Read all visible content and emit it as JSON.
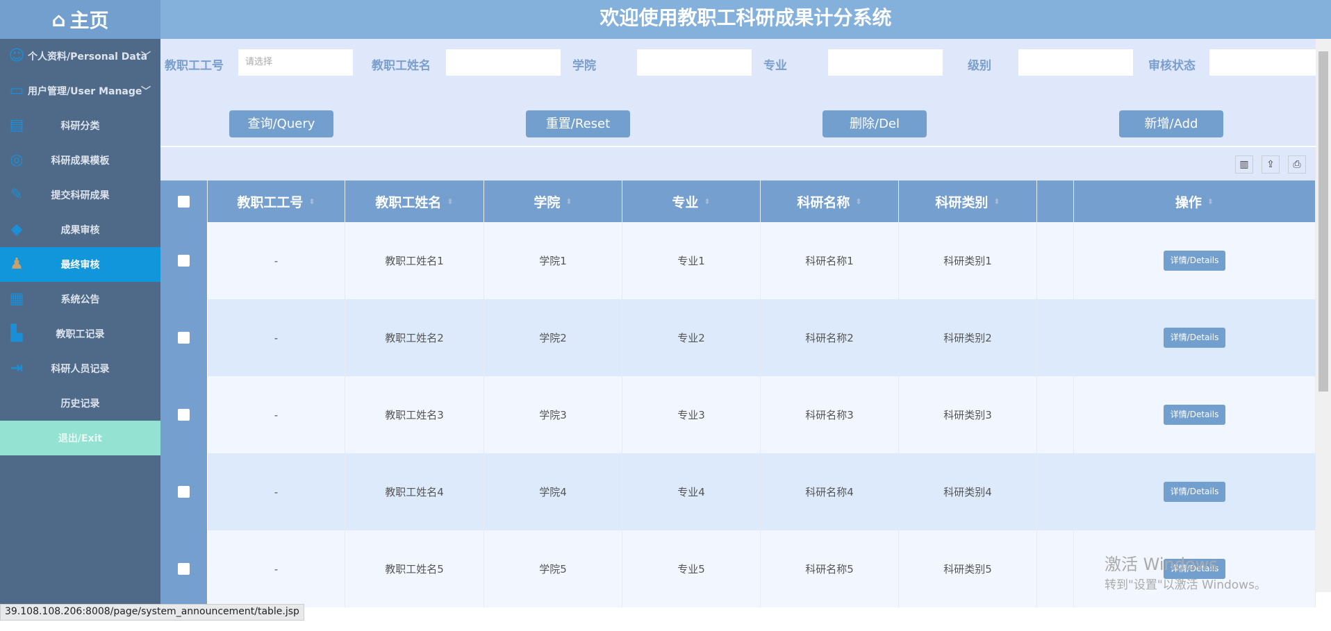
{
  "logo": {
    "label": "主页",
    "icon": "home-icon"
  },
  "header": {
    "title": "欢迎使用教职工科研成果计分系统"
  },
  "sidebar": {
    "items": [
      {
        "label": "个人资料/Personal Data",
        "icon": "user-circle-icon",
        "group": true
      },
      {
        "label": "用户管理/User Manage",
        "icon": "monitor-icon",
        "group": true
      },
      {
        "label": "科研分类",
        "icon": "id-card-icon"
      },
      {
        "label": "科研成果模板",
        "icon": "template-icon"
      },
      {
        "label": "提交科研成果",
        "icon": "pencil-icon"
      },
      {
        "label": "成果审核",
        "icon": "tag-icon"
      },
      {
        "label": "最终审核",
        "icon": "users-icon",
        "active": true
      },
      {
        "label": "系统公告",
        "icon": "notice-board-icon"
      },
      {
        "label": "教职工记录",
        "icon": "save-icon"
      },
      {
        "label": "科研人员记录",
        "icon": "sign-out-icon"
      },
      {
        "label": "历史记录",
        "icon": ""
      },
      {
        "label": "退出/Exit",
        "icon": "",
        "exit": true
      }
    ]
  },
  "search": {
    "fields": [
      {
        "label": "教职工工号",
        "value": "",
        "placeholder": "请选择"
      },
      {
        "label": "教职工姓名",
        "value": "",
        "placeholder": ""
      },
      {
        "label": "学院",
        "value": "",
        "placeholder": ""
      },
      {
        "label": "专业",
        "value": "",
        "placeholder": ""
      },
      {
        "label": "级别",
        "value": "",
        "placeholder": ""
      },
      {
        "label": "审核状态",
        "value": "",
        "placeholder": ""
      }
    ],
    "buttons": [
      "查询/Query",
      "重置/Reset",
      "删除/Del",
      "新增/Add"
    ]
  },
  "toolbar": {
    "icons": [
      "columns-icon",
      "export-icon",
      "print-icon"
    ]
  },
  "table": {
    "columns": [
      "教职工工号",
      "教职工姓名",
      "学院",
      "专业",
      "科研名称",
      "科研类别",
      "",
      "操作"
    ],
    "rows": [
      [
        "-",
        "教职工姓名1",
        "学院1",
        "专业1",
        "科研名称1",
        "科研类别1",
        ""
      ],
      [
        "-",
        "教职工姓名2",
        "学院2",
        "专业2",
        "科研名称2",
        "科研类别2",
        ""
      ],
      [
        "-",
        "教职工姓名3",
        "学院3",
        "专业3",
        "科研名称3",
        "科研类别3",
        ""
      ],
      [
        "-",
        "教职工姓名4",
        "学院4",
        "专业4",
        "科研名称4",
        "科研类别4",
        ""
      ],
      [
        "-",
        "教职工姓名5",
        "学院5",
        "专业5",
        "科研名称5",
        "科研类别5",
        ""
      ]
    ],
    "action_label": "详情/Details"
  },
  "statusbar": {
    "url": "39.108.108.206:8008/page/system_announcement/table.jsp"
  },
  "watermark": {
    "line1": "激活 Windows",
    "line2": "转到\"设置\"以激活 Windows。"
  },
  "colors": {
    "primary": "#739fcf",
    "sidebar": "#4f6a88",
    "active": "#1296db",
    "exit": "#94e2d2"
  }
}
